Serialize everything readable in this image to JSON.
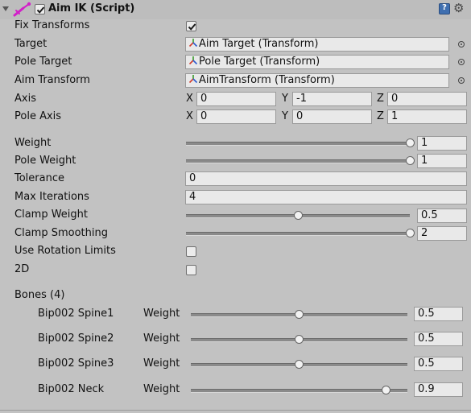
{
  "component": {
    "title": "Aim IK (Script)",
    "enabled": true,
    "icons": {
      "component": "aim-ik-script-icon",
      "help": "help-book-icon",
      "settings": "gear-icon"
    }
  },
  "fields": {
    "fix_transforms": {
      "label": "Fix Transforms",
      "checked": true
    },
    "target": {
      "label": "Target",
      "value": "Aim Target (Transform)"
    },
    "pole_target": {
      "label": "Pole Target",
      "value": "Pole Target (Transform)"
    },
    "aim_transform": {
      "label": "Aim Transform",
      "value": "AimTransform (Transform)"
    },
    "axis": {
      "label": "Axis",
      "x_label": "X",
      "y_label": "Y",
      "z_label": "Z",
      "x": "0",
      "y": "-1",
      "z": "0"
    },
    "pole_axis": {
      "label": "Pole Axis",
      "x_label": "X",
      "y_label": "Y",
      "z_label": "Z",
      "x": "0",
      "y": "0",
      "z": "1"
    },
    "weight": {
      "label": "Weight",
      "value": "1",
      "fraction": 1.0
    },
    "pole_weight": {
      "label": "Pole Weight",
      "value": "1",
      "fraction": 1.0
    },
    "tolerance": {
      "label": "Tolerance",
      "value": "0"
    },
    "max_iterations": {
      "label": "Max Iterations",
      "value": "4"
    },
    "clamp_weight": {
      "label": "Clamp Weight",
      "value": "0.5",
      "fraction": 0.5
    },
    "clamp_smoothing": {
      "label": "Clamp Smoothing",
      "value": "2",
      "fraction": 1.0
    },
    "use_rotation_limits": {
      "label": "Use Rotation Limits",
      "checked": false
    },
    "two_d": {
      "label": "2D",
      "checked": false
    }
  },
  "bones": {
    "header": "Bones (4)",
    "weight_label": "Weight",
    "items": [
      {
        "name": "Bip002 Spine1",
        "value": "0.5",
        "fraction": 0.5
      },
      {
        "name": "Bip002 Spine2",
        "value": "0.5",
        "fraction": 0.5
      },
      {
        "name": "Bip002 Spine3",
        "value": "0.5",
        "fraction": 0.5
      },
      {
        "name": "Bip002 Neck",
        "value": "0.9",
        "fraction": 0.9
      }
    ]
  },
  "colors": {
    "panel": "#c2c2c2",
    "field": "#e9e9e9",
    "script_icon": "#d21fc8",
    "transform_x": "#d33b2b",
    "transform_y": "#3a9a2a",
    "transform_z": "#2d5bd0"
  }
}
